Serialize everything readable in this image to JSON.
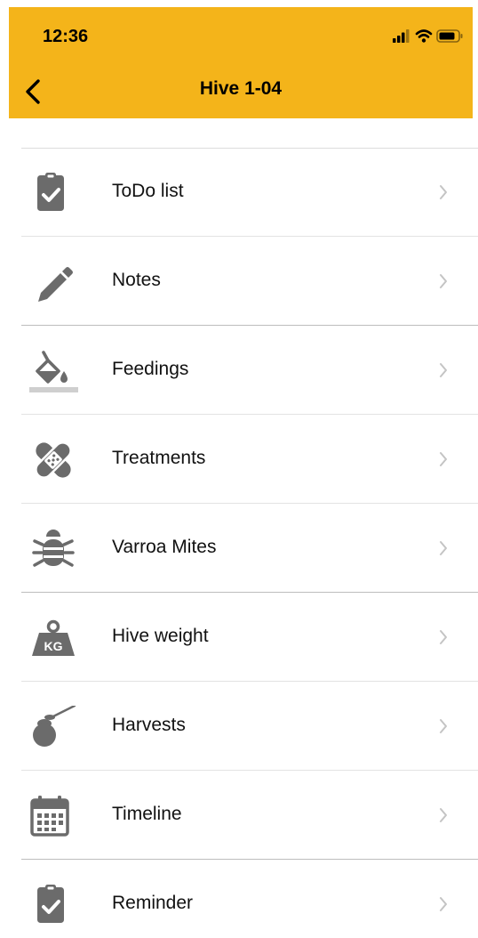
{
  "status_bar": {
    "time": "12:36"
  },
  "nav": {
    "title": "Hive 1-04"
  },
  "colors": {
    "header": "#f4b41a",
    "icon": "#6b6b6b",
    "chevron": "#c4c4c4"
  },
  "menu": [
    {
      "label": "ToDo list",
      "icon": "clipboard-check-icon"
    },
    {
      "label": "Notes",
      "icon": "pencil-icon"
    },
    {
      "label": "Feedings",
      "icon": "fill-bucket-icon"
    },
    {
      "label": "Treatments",
      "icon": "bandage-icon"
    },
    {
      "label": "Varroa Mites",
      "icon": "bug-icon"
    },
    {
      "label": "Hive weight",
      "icon": "weight-kg-icon",
      "icon_text": "KG"
    },
    {
      "label": "Harvests",
      "icon": "honey-pot-icon"
    },
    {
      "label": "Timeline",
      "icon": "calendar-icon"
    },
    {
      "label": "Reminder",
      "icon": "clipboard-check-icon"
    }
  ]
}
